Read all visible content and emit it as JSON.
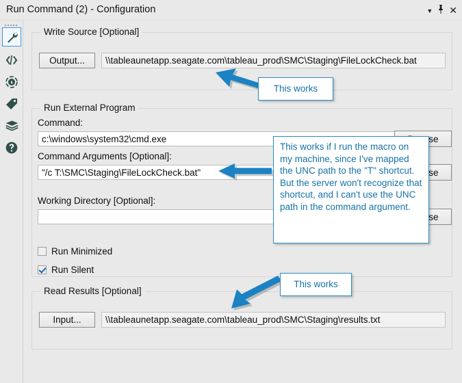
{
  "window": {
    "title": "Run Command (2) - Configuration",
    "controls": [
      {
        "name": "dropdown-caret",
        "glyph": "▼"
      },
      {
        "name": "pin",
        "glyph": "✔"
      },
      {
        "name": "close",
        "glyph": "✕"
      }
    ]
  },
  "rail": {
    "items": [
      {
        "name": "wrench-icon",
        "label": "Configuration",
        "selected": true
      },
      {
        "name": "code-icon",
        "label": "XML",
        "selected": false
      },
      {
        "name": "annotation-icon",
        "label": "Annotation",
        "selected": false
      },
      {
        "name": "tag-icon",
        "label": "Labels",
        "selected": false
      },
      {
        "name": "package-icon",
        "label": "Package",
        "selected": false
      },
      {
        "name": "help-icon",
        "label": "Help",
        "selected": false
      }
    ]
  },
  "write_source": {
    "group_title": "Write Source [Optional]",
    "output_button": "Output...",
    "path_value": "\\\\tableaunetapp.seagate.com\\tableau_prod\\SMC\\Staging\\FileLockCheck.bat"
  },
  "run_external": {
    "group_title": "Run External Program",
    "command_label": "Command:",
    "command_value": "c:\\windows\\system32\\cmd.exe",
    "command_browse_button": "Browse",
    "arguments_label": "Command Arguments [Optional]:",
    "arguments_value": "\"/c T:\\SMC\\Staging\\FileLockCheck.bat\"",
    "arguments_browse_button": "Browse",
    "working_dir_label": "Working Directory [Optional]:",
    "working_dir_value": "",
    "working_dir_browse_button": "Browse",
    "run_minimized_label": "Run Minimized",
    "run_minimized_checked": false,
    "run_silent_label": "Run Silent",
    "run_silent_checked": true
  },
  "read_results": {
    "group_title": "Read Results [Optional]",
    "input_button": "Input...",
    "path_value": "\\\\tableaunetapp.seagate.com\\tableau_prod\\SMC\\Staging\\results.txt"
  },
  "annotations": {
    "top": "This works",
    "middle": "This works if I run the macro on my machine, since I've mapped the UNC path to the \"T\" shortcut.  But the server won't recognize that shortcut, and I can't use the UNC path in the command argument.",
    "bottom": "This works"
  },
  "colors": {
    "accent_blue": "#1b82c4",
    "callout_text": "#1673a8",
    "callout_border": "#2b8cc4",
    "selection_blue": "#3d97df",
    "icon_dark": "#2f4f4a",
    "panel_bg": "#e9e9e9",
    "field_bg": "#ffffff"
  }
}
